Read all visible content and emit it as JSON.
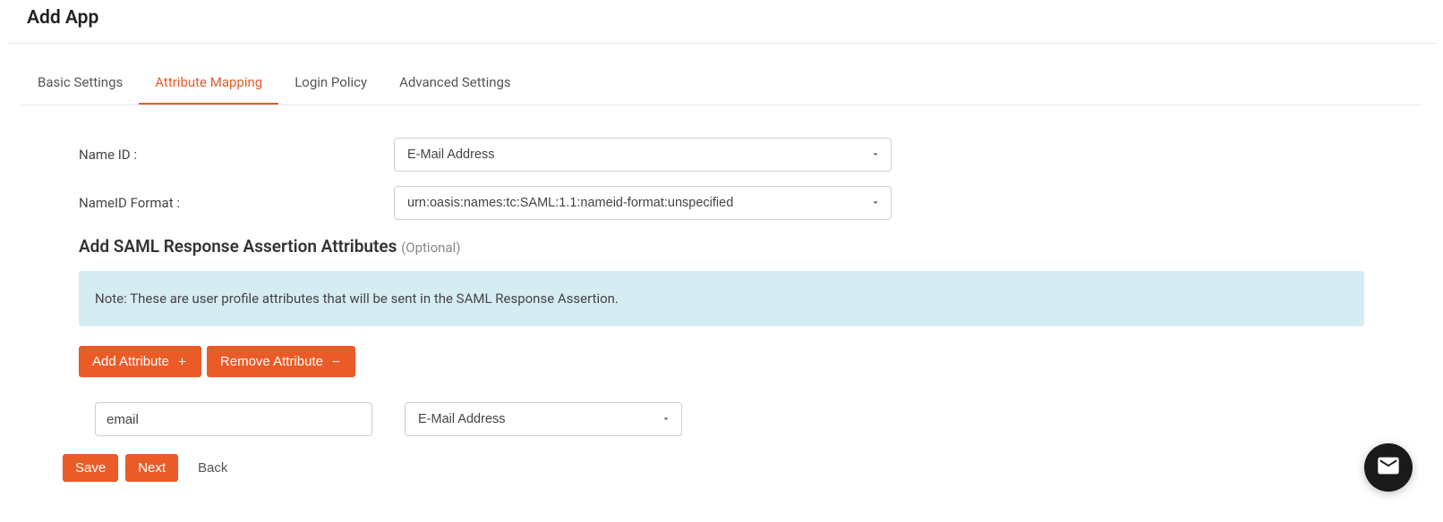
{
  "page": {
    "title": "Add App"
  },
  "tabs": [
    {
      "label": "Basic Settings"
    },
    {
      "label": "Attribute Mapping"
    },
    {
      "label": "Login Policy"
    },
    {
      "label": "Advanced Settings"
    }
  ],
  "form": {
    "nameid_label": "Name ID :",
    "nameid_value": "E-Mail Address",
    "nameid_format_label": "NameID Format :",
    "nameid_format_value": "urn:oasis:names:tc:SAML:1.1:nameid-format:unspecified"
  },
  "section": {
    "title": "Add SAML Response Assertion Attributes",
    "optional": "(Optional)"
  },
  "info": {
    "text": "Note: These are user profile attributes that will be sent in the SAML Response Assertion."
  },
  "buttons": {
    "add_attribute": "Add Attribute",
    "remove_attribute": "Remove Attribute",
    "save": "Save",
    "next": "Next",
    "back": "Back"
  },
  "attribute_row": {
    "key": "email",
    "value": "E-Mail Address"
  }
}
